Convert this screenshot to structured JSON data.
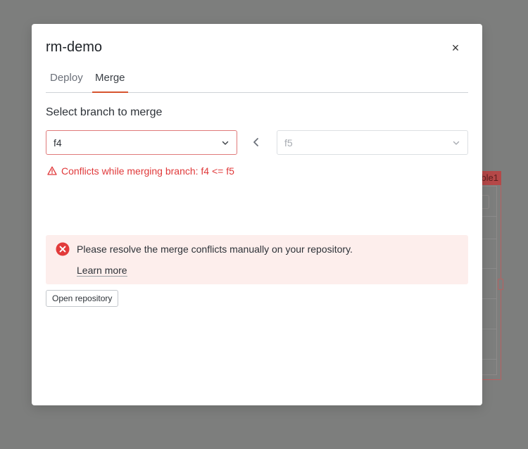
{
  "background": {
    "widget_label": "ble1"
  },
  "modal": {
    "title": "rm-demo",
    "close_symbol": "×",
    "tabs": [
      {
        "label": "Deploy",
        "active": false
      },
      {
        "label": "Merge",
        "active": true
      }
    ],
    "section_label": "Select branch to merge",
    "target_branch": {
      "value": "f4"
    },
    "source_branch": {
      "value": "f5"
    },
    "conflict_message": "Conflicts while merging branch: f4 <= f5",
    "alert": {
      "text": "Please resolve the merge conflicts manually on your repository.",
      "link_label": "Learn more"
    },
    "open_repo_label": "Open repository"
  },
  "colors": {
    "accent": "#d6542e",
    "error": "#e0393a",
    "alert_bg": "#fdeeec"
  },
  "icons": {
    "close": "close-icon",
    "chevron": "chevron-down-icon",
    "arrow": "chevron-left-icon",
    "warning": "warning-triangle-icon",
    "error": "error-circle-icon"
  }
}
